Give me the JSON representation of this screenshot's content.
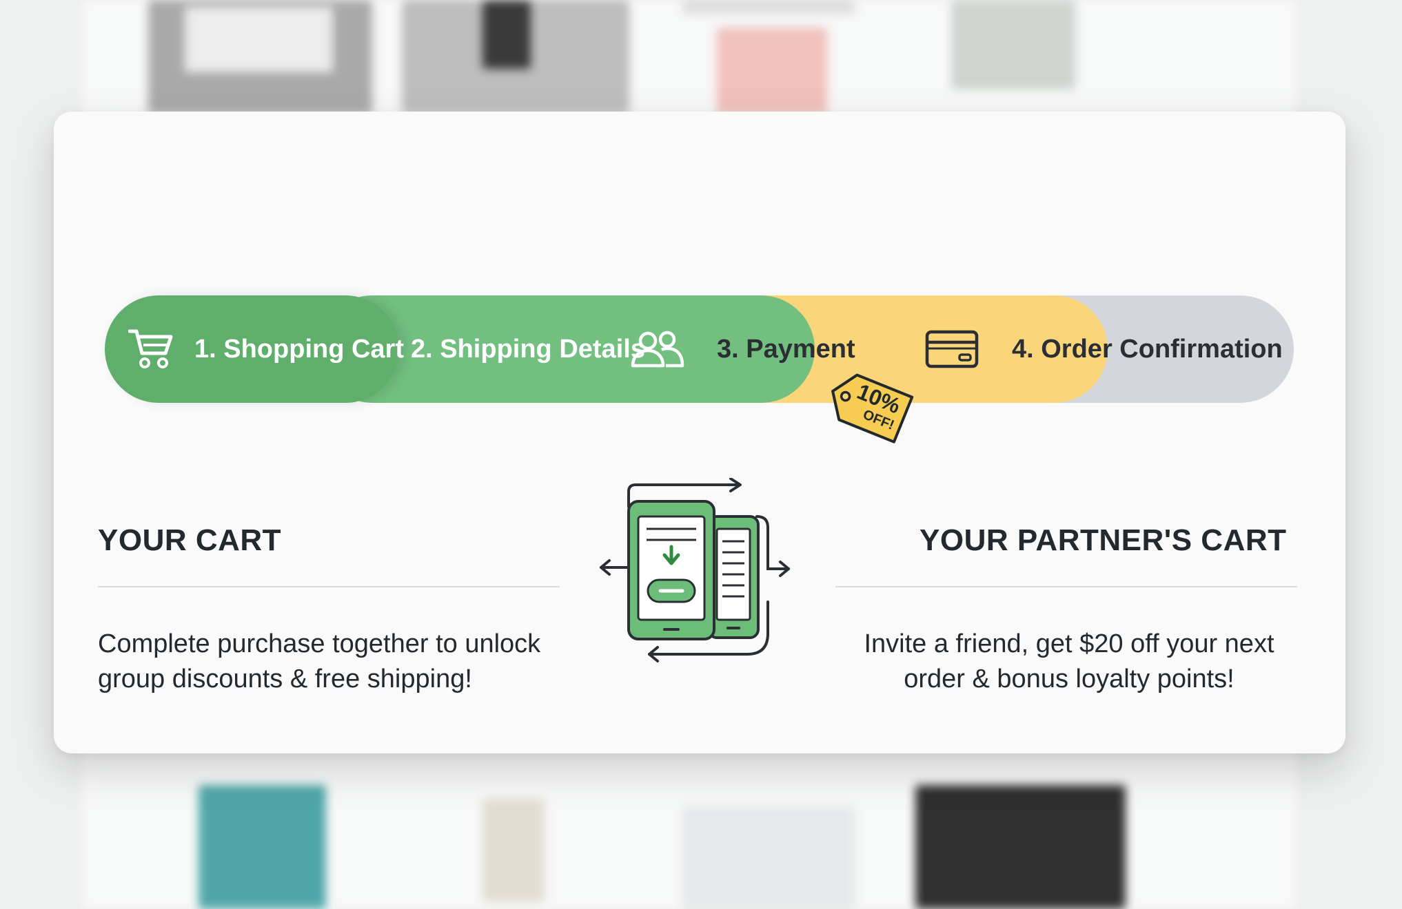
{
  "steps": [
    {
      "label": "1. Shopping Cart",
      "icon": "cart-icon",
      "state": "completed"
    },
    {
      "label": "2. Shipping Details",
      "icon": "users-icon",
      "state": "completed"
    },
    {
      "label": "3. Payment",
      "icon": "credit-card-icon",
      "state": "current"
    },
    {
      "label": "4. Order Confirmation",
      "icon": "",
      "state": "upcoming"
    }
  ],
  "discount_tag": {
    "percent": "10%",
    "suffix": "OFF!"
  },
  "your_cart": {
    "heading": "YOUR CART",
    "text": "Complete purchase together to unlock group discounts & free shipping!"
  },
  "partner_cart": {
    "heading": "YOUR PARTNER'S CART",
    "text": "Invite a friend, get $20 off your next order & bonus loyalty points!"
  },
  "center_icon": "phone-sync-icon",
  "colors": {
    "step_complete": "#72bf80",
    "step_current": "#fad57a",
    "step_upcoming": "#d3d6db",
    "icon_green": "#5cb46a"
  }
}
